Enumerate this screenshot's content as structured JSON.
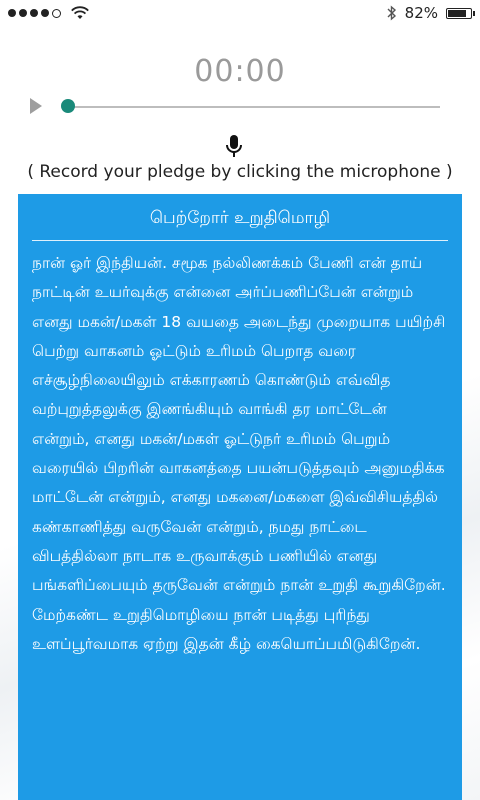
{
  "status_bar": {
    "battery_text": "82%",
    "battery_level": 0.82,
    "icons": [
      "signal-dots-icon",
      "wifi-icon",
      "bluetooth-icon",
      "battery-icon"
    ]
  },
  "player": {
    "time": "00:00",
    "progress": 0
  },
  "instruction": "( Record your pledge by clicking the microphone )",
  "pledge": {
    "title": "பெற்றோர் உறுதிமொழி",
    "body": "நான் ஓர் இந்தியன். சமூக நல்லிணக்கம் பேணி என் தாய் நாட்டின் உயர்வுக்கு என்னை அர்ப்பணிப்பேன் என்றும் எனது மகன்/மகள் 18 வயதை அடைந்து முறையாக பயிற்சி பெற்று வாகனம் ஓட்டும் உரிமம் பெறாத வரை எச்சூழ்நிலையிலும் எக்காரணம் கொண்டும் எவ்வித வற்புறுத்தலுக்கு இணங்கியும் வாங்கி தர மாட்டேன் என்றும், எனது மகன்/மகள் ஓட்டுநர் உரிமம் பெறும் வரையில் பிறரின் வாகனத்தை பயன்படுத்தவும் அனுமதிக்க மாட்டேன் என்றும், எனது மகனை/மகளை இவ்விசியத்தில் கண்காணித்து வருவேன் என்றும், நமது நாட்டை விபத்தில்லா நாடாக உருவாக்கும் பணியில் எனது பங்களிப்பையும் தருவேன் என்றும் நான் உறுதி கூறுகிறேன். மேற்கண்ட உறுதிமொழியை நான் படித்து புரிந்து உளப்பூர்வமாக ஏற்று இதன் கீழ் கையொப்பமிடுகிறேன்."
  },
  "colors": {
    "accent_teal": "#1a8a7a",
    "card_blue": "#1e9be6"
  }
}
